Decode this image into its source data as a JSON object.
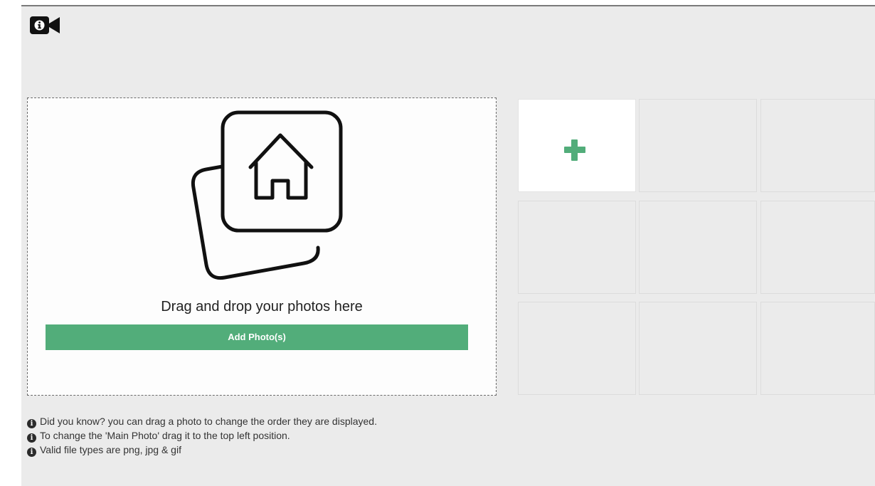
{
  "header": {
    "icon": "info-video-icon"
  },
  "dropzone": {
    "illustration_icon": "photos-house-icon",
    "instruction": "Drag and drop your photos here",
    "button_label": "Add Photo(s)",
    "button_color": "#52ad7a"
  },
  "tips": [
    {
      "icon": "info-circle-icon",
      "text": "Did you know? you can drag a photo to change the order they are displayed."
    },
    {
      "icon": "info-circle-icon",
      "text": "To change the 'Main Photo' drag it to the top left position."
    },
    {
      "icon": "info-circle-icon",
      "text": "Valid file types are png, jpg & gif"
    }
  ],
  "photo_grid": {
    "add_slot_icon": "plus-icon",
    "accent_color": "#52ad7a",
    "empty_slot_count": 8
  },
  "colors": {
    "panel_background": "#ebebeb",
    "dropzone_background": "#fdfdfd",
    "accent": "#52ad7a"
  }
}
